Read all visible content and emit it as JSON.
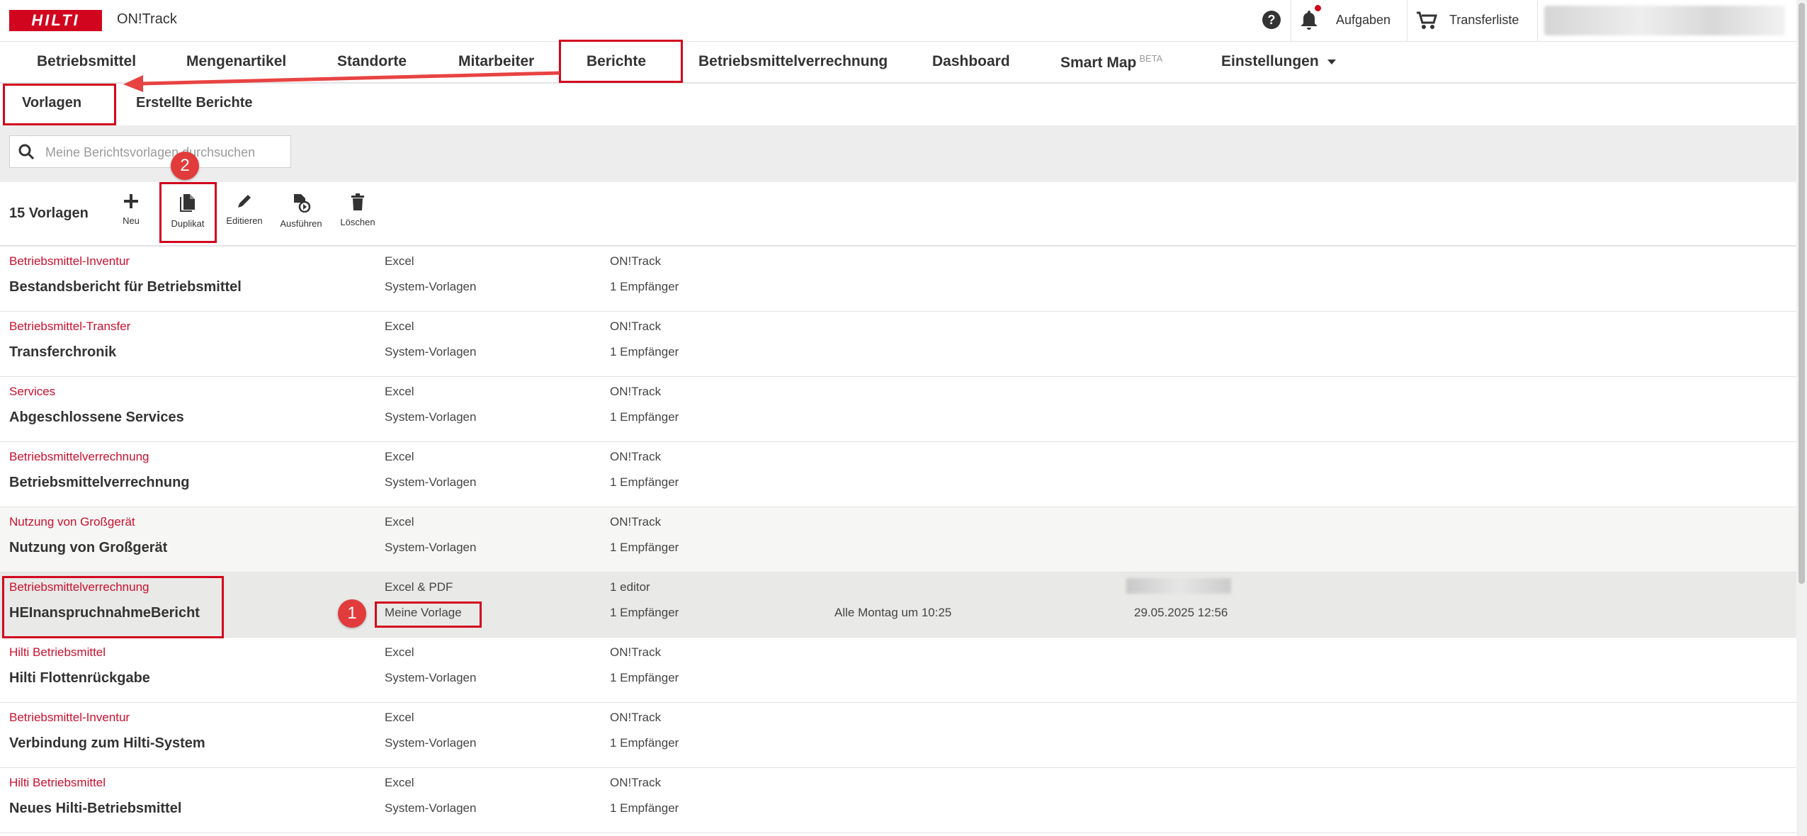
{
  "brand": {
    "logo": "HILTI",
    "app_name": "ON!Track",
    "accent": "#d2051e"
  },
  "topbar": {
    "help_symbol": "?",
    "tasks_label": "Aufgaben",
    "transfer_label": "Transferliste"
  },
  "nav": {
    "items": [
      "Betriebsmittel",
      "Mengenartikel",
      "Standorte",
      "Mitarbeiter",
      "Berichte",
      "Betriebsmittelverrechnung",
      "Dashboard",
      "Smart Map",
      "Einstellungen"
    ],
    "smartmap_badge": "BETA",
    "active": "Berichte"
  },
  "subnav": {
    "items": [
      "Vorlagen",
      "Erstellte Berichte"
    ],
    "active": "Vorlagen"
  },
  "search": {
    "placeholder": "Meine Berichtsvorlagen durchsuchen"
  },
  "toolbar": {
    "count": "15 Vorlagen",
    "actions": [
      "Neu",
      "Duplikat",
      "Editieren",
      "Ausführen",
      "Löschen"
    ]
  },
  "rows": [
    {
      "category": "Betriebsmittel-Inventur",
      "title": "Bestandsbericht für Betriebsmittel",
      "format": "Excel",
      "template_type": "System-Vorlagen",
      "owner": "ON!Track",
      "recipients": "1 Empfänger",
      "schedule": "",
      "date": ""
    },
    {
      "category": "Betriebsmittel-Transfer",
      "title": "Transferchronik",
      "format": "Excel",
      "template_type": "System-Vorlagen",
      "owner": "ON!Track",
      "recipients": "1 Empfänger",
      "schedule": "",
      "date": ""
    },
    {
      "category": "Services",
      "title": "Abgeschlossene Services",
      "format": "Excel",
      "template_type": "System-Vorlagen",
      "owner": "ON!Track",
      "recipients": "1 Empfänger",
      "schedule": "",
      "date": ""
    },
    {
      "category": "Betriebsmittelverrechnung",
      "title": "Betriebsmittelverrechnung",
      "format": "Excel",
      "template_type": "System-Vorlagen",
      "owner": "ON!Track",
      "recipients": "1 Empfänger",
      "schedule": "",
      "date": ""
    },
    {
      "category": "Nutzung von Großgerät",
      "title": "Nutzung von Großgerät",
      "format": "Excel",
      "template_type": "System-Vorlagen",
      "owner": "ON!Track",
      "recipients": "1 Empfänger",
      "schedule": "",
      "date": ""
    },
    {
      "category": "Betriebsmittelverrechnung",
      "title": "HEInanspruchnahmeBericht",
      "format": "Excel & PDF",
      "template_type": "Meine Vorlage",
      "owner": "1 editor",
      "recipients": "1 Empfänger",
      "schedule": "Alle Montag um 10:25",
      "date": "29.05.2025 12:56"
    },
    {
      "category": "Hilti Betriebsmittel",
      "title": "Hilti Flottenrückgabe",
      "format": "Excel",
      "template_type": "System-Vorlagen",
      "owner": "ON!Track",
      "recipients": "1 Empfänger",
      "schedule": "",
      "date": ""
    },
    {
      "category": "Betriebsmittel-Inventur",
      "title": "Verbindung zum Hilti-System",
      "format": "Excel",
      "template_type": "System-Vorlagen",
      "owner": "ON!Track",
      "recipients": "1 Empfänger",
      "schedule": "",
      "date": ""
    },
    {
      "category": "Hilti Betriebsmittel",
      "title": "Neues Hilti-Betriebsmittel",
      "format": "Excel",
      "template_type": "System-Vorlagen",
      "owner": "ON!Track",
      "recipients": "1 Empfänger",
      "schedule": "",
      "date": ""
    }
  ],
  "annotations": {
    "badge_1": "1",
    "badge_2": "2",
    "color": "#d2051e"
  }
}
